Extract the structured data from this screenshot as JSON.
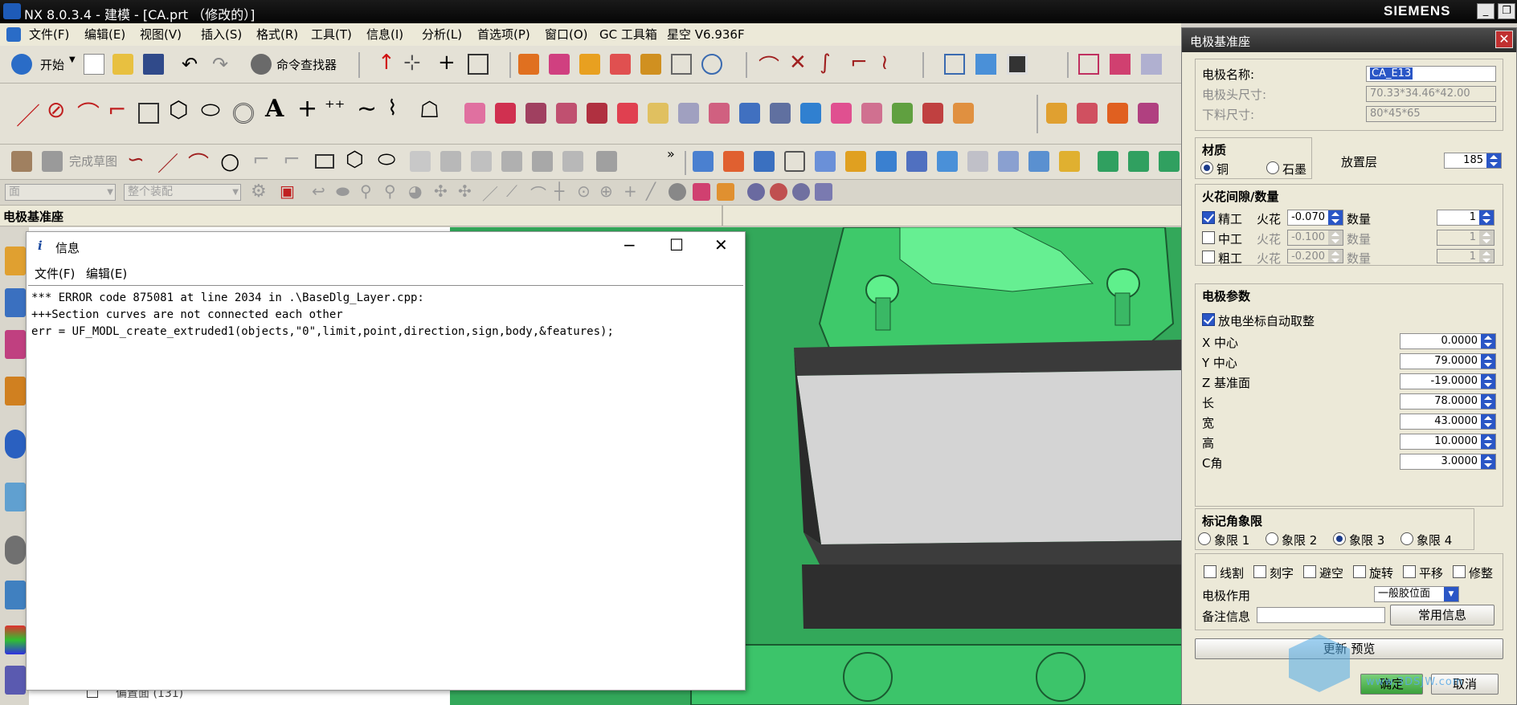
{
  "app": {
    "title": "NX 8.0.3.4 - 建模 - [CA.prt （修改的）]",
    "brand": "SIEMENS"
  },
  "menu": [
    "文件(F)",
    "编辑(E)",
    "视图(V)",
    "插入(S)",
    "格式(R)",
    "工具(T)",
    "信息(I)",
    "分析(L)",
    "首选项(P)",
    "窗口(O)",
    "GC 工具箱",
    "星空 V6.936F"
  ],
  "toolbar": {
    "start_label": "开始",
    "command_finder": "命令查找器",
    "finish_sketch": "完成草图",
    "selection_filter": "面",
    "assembly_scope": "整个装配"
  },
  "panel_title": "电极基准座",
  "info": {
    "title": "信息",
    "menu": [
      "文件(F)",
      "编辑(E)"
    ],
    "lines": [
      "*** ERROR code 875081 at line 2034 in .\\BaseDlg_Layer.cpp:",
      "+++Section curves are not connected each other",
      "err = UF_MODL_create_extruded1(objects,\"0\",limit,point,direction,sign,body,&features);"
    ]
  },
  "tree": {
    "bottom_item": "偏置面 (131)"
  },
  "dialog": {
    "title": "电极基准座",
    "electrode_name_label": "电极名称:",
    "electrode_name": "CA_E13",
    "head_size_label": "电极头尺寸:",
    "head_size": "70.33*34.46*42.00",
    "stock_size_label": "下料尺寸:",
    "stock_size": "80*45*65",
    "material_title": "材质",
    "material_copper": "铜",
    "material_graphite": "石墨",
    "layer_label": "放置层",
    "layer_value": "185",
    "spark_title": "火花间隙/数量",
    "finish_label": "精工",
    "medium_label": "中工",
    "rough_label": "粗工",
    "spark_label": "火花",
    "qty_label": "数量",
    "spark_values": [
      "-0.070",
      "-0.100",
      "-0.200"
    ],
    "qty_values": [
      "1",
      "1",
      "1"
    ],
    "params_title": "电极参数",
    "auto_adjust_label": "放电坐标自动取整",
    "params": [
      {
        "label": "X 中心",
        "value": "0.0000"
      },
      {
        "label": "Y 中心",
        "value": "79.0000"
      },
      {
        "label": "Z 基准面",
        "value": "-19.0000"
      },
      {
        "label": "长",
        "value": "78.0000"
      },
      {
        "label": "宽",
        "value": "43.0000"
      },
      {
        "label": "高",
        "value": "10.0000"
      },
      {
        "label": "C角",
        "value": "3.0000"
      }
    ],
    "quadrant_title": "标记角象限",
    "quadrants": [
      "象限 1",
      "象限 2",
      "象限 3",
      "象限 4"
    ],
    "options": [
      "线割",
      "刻字",
      "避空",
      "旋转",
      "平移",
      "修整"
    ],
    "usage_label": "电极作用",
    "usage_value": "一般胶位面",
    "remark_label": "备注信息",
    "common_info": "常用信息",
    "update_preview": "更新 预览",
    "ok": "确定",
    "cancel": "取消"
  },
  "watermark": {
    "text": "www.3DSJW.com"
  }
}
